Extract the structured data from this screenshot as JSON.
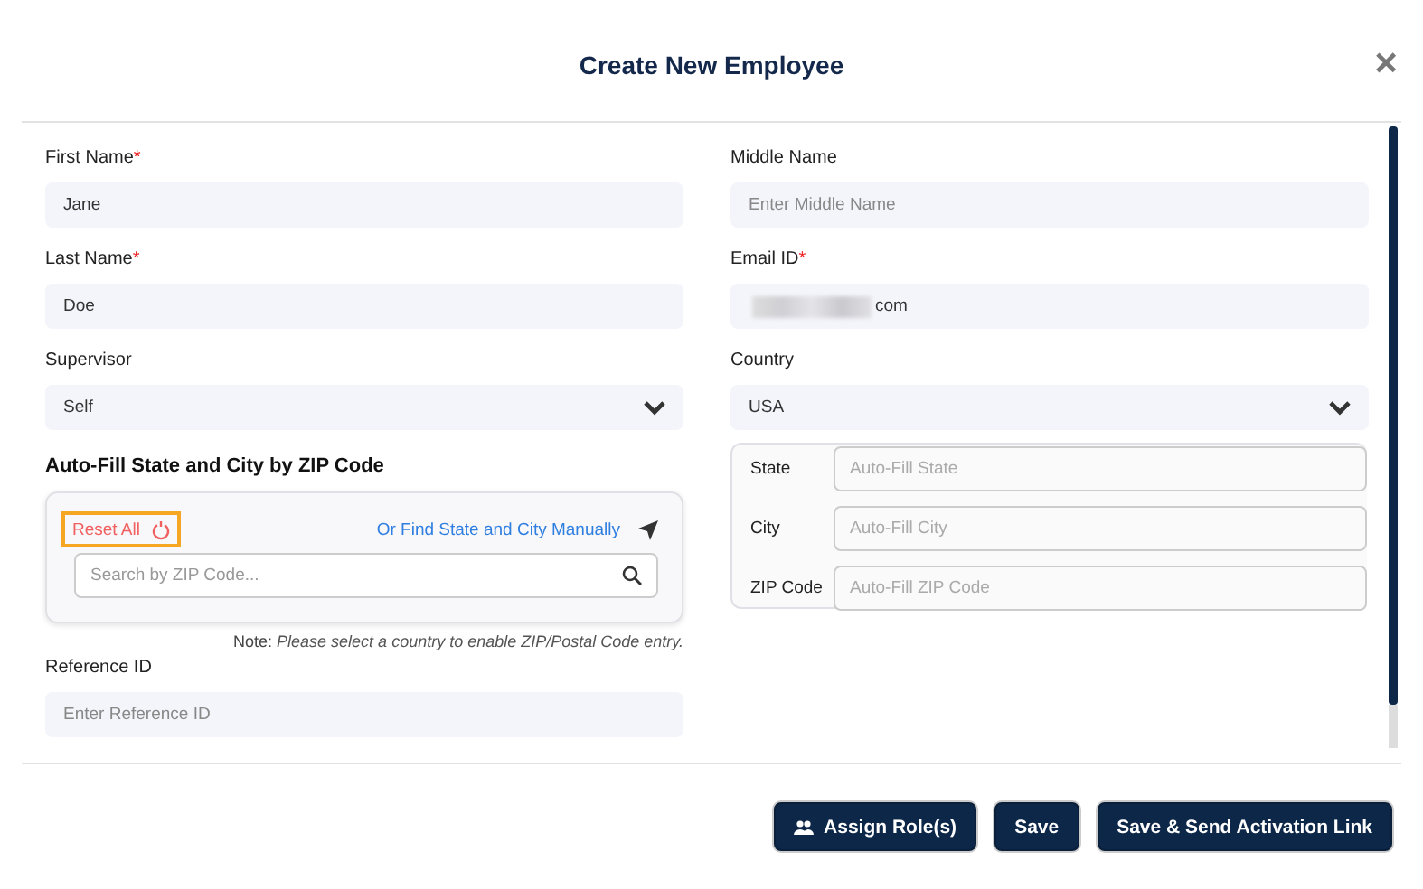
{
  "dialog": {
    "title": "Create New Employee",
    "close": "×"
  },
  "fields": [
    {
      "kind": "input",
      "label": "First Name",
      "required_mark": "*",
      "value": "Jane"
    },
    {
      "kind": "input",
      "label": "Middle Name",
      "placeholder": "Enter Middle Name"
    },
    {
      "kind": "input",
      "label": "Last Name",
      "required_mark": "*",
      "value": "Doe"
    },
    {
      "kind": "email",
      "label": "Email ID",
      "required_mark": "*",
      "value": "com"
    },
    {
      "kind": "select",
      "label": "Supervisor",
      "value": "Self"
    },
    {
      "kind": "select",
      "label": "Country",
      "value": "USA"
    }
  ],
  "zip_lookup": {
    "heading": "Auto-Fill State and City by ZIP Code",
    "reset": "Reset All",
    "manual_link": "Or Find State and City Manually",
    "search_placeholder": "Search by ZIP Code...",
    "note_label": "Note:",
    "note": "Please select a country to enable ZIP/Postal Code entry."
  },
  "address": [
    {
      "label": "State",
      "placeholder": "Auto-Fill State"
    },
    {
      "label": "City",
      "placeholder": "Auto-Fill City"
    },
    {
      "label": "ZIP Code",
      "placeholder": "Auto-Fill ZIP Code"
    }
  ],
  "reference": {
    "label": "Reference ID",
    "placeholder": "Enter Reference ID"
  },
  "buttons": [
    {
      "kind": "icon",
      "label": "Assign Role(s)"
    },
    {
      "kind": "plain",
      "label": "Save"
    },
    {
      "kind": "plain",
      "label": "Save & Send Activation Link"
    }
  ]
}
